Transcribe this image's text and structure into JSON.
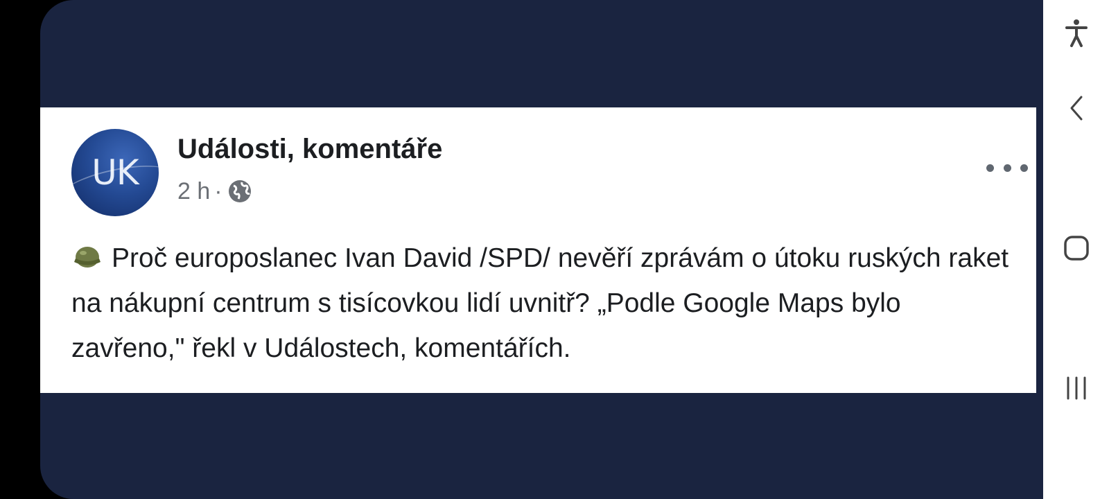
{
  "post": {
    "page_name": "Události, komentáře",
    "avatar_text": "UK",
    "time": "2 h",
    "separator": "·",
    "privacy_icon": "globe-icon",
    "text": "Proč europoslanec Ivan David /SPD/ nevěří zprávám o útoku ruských raket na nákupní centrum s tisícovkou lidí uvnitř? „Podle Google Maps bylo zavřeno,\" řekl v Událostech, komentářích.",
    "leading_emoji": "helmet-icon"
  },
  "nav": {
    "icons": [
      "accessibility-icon",
      "back-icon",
      "home-icon",
      "recents-icon"
    ]
  },
  "colors": {
    "background": "#1a2440",
    "card": "#ffffff",
    "text": "#1c1e21",
    "meta": "#6b6f75"
  }
}
